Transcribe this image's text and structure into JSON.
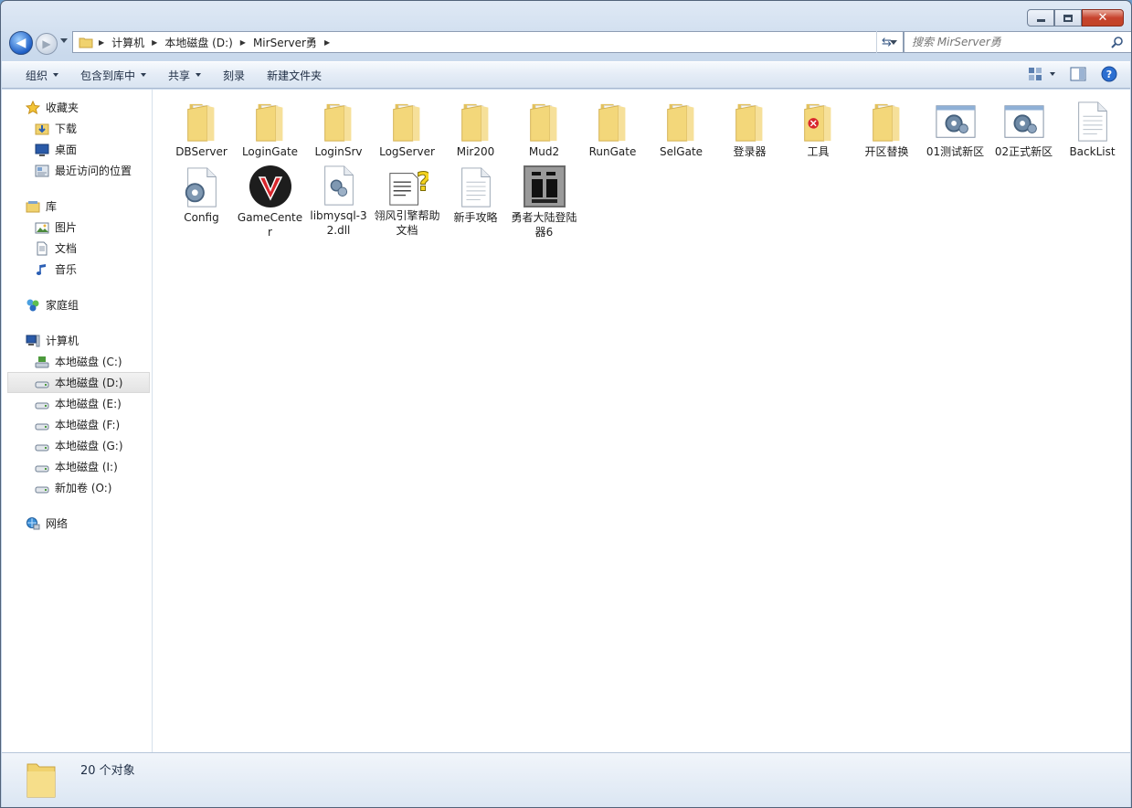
{
  "window": {
    "address": {
      "segments": [
        "计算机",
        "本地磁盘 (D:)",
        "MirServer勇"
      ]
    },
    "search_placeholder": "搜索 MirServer勇",
    "caption_buttons": {
      "minimize": "minimize-icon",
      "maximize": "maximize-icon",
      "close": "close-icon"
    }
  },
  "toolbar": {
    "organize": "组织",
    "include_library": "包含到库中",
    "share": "共享",
    "burn": "刻录",
    "new_folder": "新建文件夹"
  },
  "sidebar": {
    "favorites": {
      "label": "收藏夹",
      "items": [
        "下载",
        "桌面",
        "最近访问的位置"
      ]
    },
    "libraries": {
      "label": "库",
      "items": [
        "图片",
        "文档",
        "音乐"
      ]
    },
    "homegroup": "家庭组",
    "computer": {
      "label": "计算机",
      "items": [
        "本地磁盘 (C:)",
        "本地磁盘 (D:)",
        "本地磁盘 (E:)",
        "本地磁盘 (F:)",
        "本地磁盘 (G:)",
        "本地磁盘 (I:)",
        "新加卷 (O:)"
      ]
    },
    "network": "网络"
  },
  "files": [
    {
      "name": "DBServer",
      "type": "folder"
    },
    {
      "name": "LoginGate",
      "type": "folder"
    },
    {
      "name": "LoginSrv",
      "type": "folder"
    },
    {
      "name": "LogServer",
      "type": "folder"
    },
    {
      "name": "Mir200",
      "type": "folder"
    },
    {
      "name": "Mud2",
      "type": "folder"
    },
    {
      "name": "RunGate",
      "type": "folder"
    },
    {
      "name": "SelGate",
      "type": "folder"
    },
    {
      "name": "登录器",
      "type": "folder"
    },
    {
      "name": "工具",
      "type": "folder"
    },
    {
      "name": "开区替换",
      "type": "folder"
    },
    {
      "name": "01测试新区",
      "type": "settings"
    },
    {
      "name": "02正式新区",
      "type": "settings"
    },
    {
      "name": "BackList",
      "type": "text"
    },
    {
      "name": "Config",
      "type": "config"
    },
    {
      "name": "GameCenter",
      "type": "game"
    },
    {
      "name": "libmysql-32.dll",
      "type": "dll"
    },
    {
      "name": "翎风引擎帮助文档",
      "type": "help"
    },
    {
      "name": "新手攻略",
      "type": "text"
    },
    {
      "name": "勇者大陆登陆器6",
      "type": "launcher"
    }
  ],
  "status": {
    "count": "20 个对象"
  },
  "colors": {
    "folder": "#f3d77a",
    "selection": "#e3e3e3",
    "accent": "#1f5fc6"
  }
}
